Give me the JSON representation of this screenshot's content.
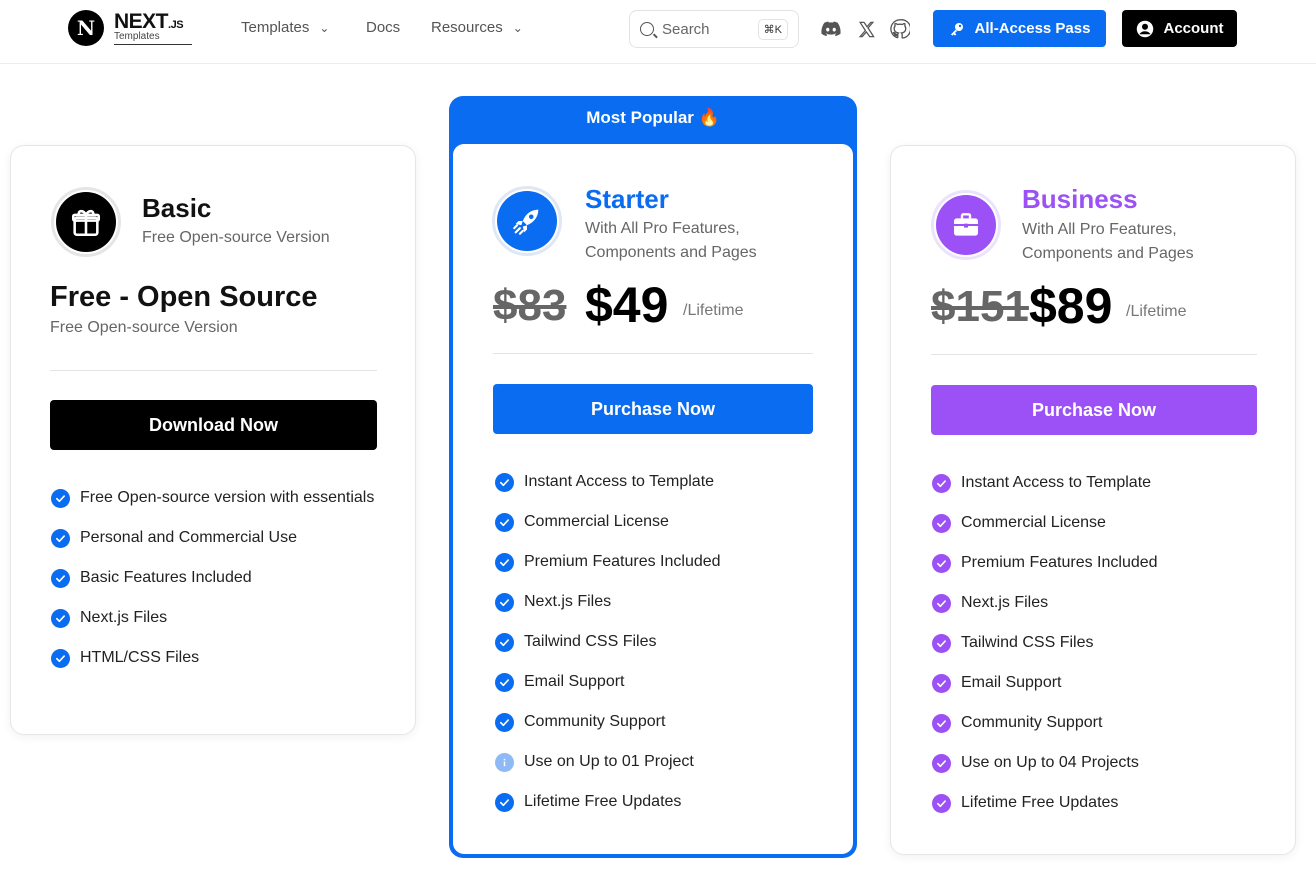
{
  "brand": {
    "logo_letter": "N",
    "name": "NEXT",
    "suffix": ".JS",
    "sub": "Templates"
  },
  "nav": {
    "templates": "Templates",
    "docs": "Docs",
    "resources": "Resources",
    "search_placeholder": "Search",
    "shortcut": "⌘K",
    "all_access": "All-Access Pass",
    "account": "Account"
  },
  "colors": {
    "blue": "#0a6cf0",
    "purple": "#9b51f5",
    "black": "#000000",
    "info_light_blue": "#8fb9f5"
  },
  "plans": {
    "basic": {
      "name": "Basic",
      "subtitle": "Free Open-source Version",
      "headline": "Free - Open Source",
      "headline_sub": "Free Open-source Version",
      "cta": "Download Now",
      "features": [
        "Free Open-source version with essentials",
        "Personal and Commercial Use",
        "Basic Features Included",
        "Next.js Files",
        "HTML/CSS Files"
      ]
    },
    "starter": {
      "badge": "Most Popular 🔥",
      "name": "Starter",
      "subtitle_line1": "With All Pro Features,",
      "subtitle_line2": "Components and Pages",
      "old_price": "$83",
      "price": "$49",
      "period": "/Lifetime",
      "cta": "Purchase Now",
      "features": [
        "Instant Access to Template",
        "Commercial License",
        "Premium Features Included",
        "Next.js Files",
        "Tailwind CSS Files",
        "Email Support",
        "Community Support",
        "Use on Up to 01 Project",
        "Lifetime Free Updates"
      ]
    },
    "business": {
      "name": "Business",
      "subtitle_line1": "With All Pro Features,",
      "subtitle_line2": "Components and Pages",
      "old_price": "$151",
      "price": "$89",
      "period": "/Lifetime",
      "cta": "Purchase Now",
      "features": [
        "Instant Access to Template",
        "Commercial License",
        "Premium Features Included",
        "Next.js Files",
        "Tailwind CSS Files",
        "Email Support",
        "Community Support",
        "Use on Up to 04 Projects",
        "Lifetime Free Updates"
      ]
    }
  }
}
